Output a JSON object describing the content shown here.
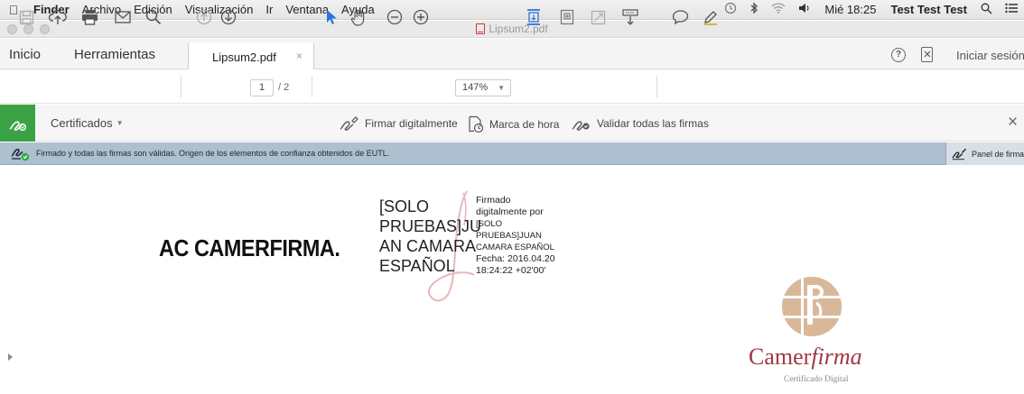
{
  "menubar": {
    "items": [
      "Finder",
      "Archivo",
      "Edición",
      "Visualización",
      "Ir",
      "Ventana",
      "Ayuda"
    ],
    "clock": "Mié 18:25",
    "user": "Test Test Test"
  },
  "window": {
    "title": "Lipsum2.pdf"
  },
  "tabs": {
    "home": "Inicio",
    "tools": "Herramientas",
    "document": "Lipsum2.pdf",
    "close_symbol": "×",
    "sign_in": "Iniciar sesión",
    "help_symbol": "?"
  },
  "toolbar": {
    "current_page": "1",
    "page_total": "/ 2",
    "zoom": "147%"
  },
  "certificates": {
    "title": "Certificados",
    "actions": [
      "Firmar digitalmente",
      "Marca de hora",
      "Validar todas las firmas"
    ],
    "close_symbol": "×"
  },
  "signature_bar": {
    "message": "Firmado y todas las firmas son válidas. Origen de los elementos de confianza obtenidos de EUTL.",
    "panel_button": "Panel de firma"
  },
  "document": {
    "heading": "AC CAMERFIRMA.",
    "signer_lines": [
      "[SOLO",
      "PRUEBAS]JU",
      "AN CAMARA",
      "ESPAÑOL"
    ],
    "signature_details": {
      "line1": "Firmado",
      "line2": "digitalmente por",
      "line3": "[SOLO",
      "line4": "PRUEBAS]JUAN",
      "line5": "CAMARA ESPAÑOL",
      "line6": "Fecha: 2016.04.20",
      "line7": "18:24:22 +02'00'"
    },
    "logo": {
      "brand_prefix": "C",
      "brand_regular": "amer",
      "brand_italic": "firma",
      "subtitle": "Certificado Digital"
    }
  },
  "colors": {
    "cert_accent": "#3aa245",
    "signature_bar": "#aebfcf",
    "brand": "#a13944",
    "logo_tan": "#d9b89a"
  }
}
